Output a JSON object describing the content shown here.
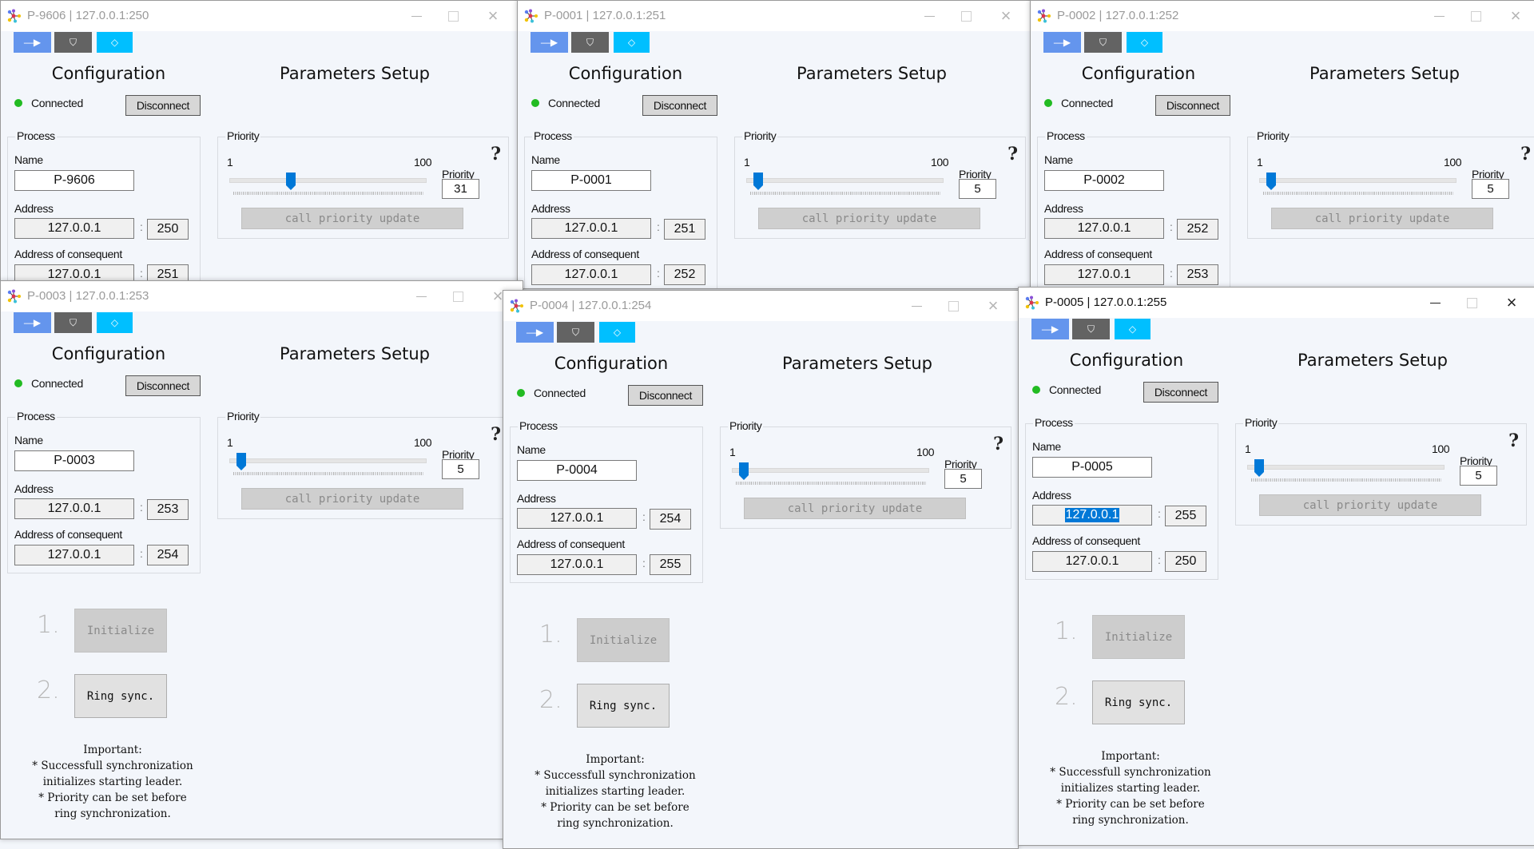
{
  "colors": {
    "toolbar_blue": "#6495ed",
    "toolbar_gray": "#636363",
    "toolbar_cyan": "#00bfff",
    "status_connected": "#22bb22",
    "slider_thumb": "#0078d7",
    "selection": "#0078d7"
  },
  "labels": {
    "configuration": "Configuration",
    "parameters_setup": "Parameters Setup",
    "status": "Connected",
    "disconnect": "Disconnect",
    "process_group": "Process",
    "name": "Name",
    "address": "Address",
    "address_of_consequent": "Address of consequent",
    "priority_group": "Priority",
    "slider_min": "1",
    "slider_max": "100",
    "priority_field": "Priority",
    "call_priority_update": "call priority update",
    "colon": ":",
    "help": "?",
    "step1_num": "1.",
    "step1_btn": "Initialize",
    "step2_num": "2.",
    "step2_btn": "Ring sync.",
    "note_lines": [
      "Important:",
      "* Successfull synchronization",
      "initializes starting leader.",
      "* Priority can be set before",
      "ring synchronization."
    ]
  },
  "toolbar": [
    {
      "icon": "arrow-right-icon",
      "glyph": "—▶"
    },
    {
      "icon": "shield-icon",
      "glyph": "⛉"
    },
    {
      "icon": "diamond-icon",
      "glyph": "◇"
    }
  ],
  "window_controls": {
    "minimize": "minimize",
    "maximize": "maximize",
    "close": "×"
  },
  "windows": [
    {
      "title": "P-9606 | 127.0.0.1:250",
      "name": "P-9606",
      "address": "127.0.0.1",
      "port": "250",
      "next_address": "127.0.0.1",
      "next_port": "251",
      "priority": "31",
      "slider_value": 31,
      "active": false,
      "address_selected": false
    },
    {
      "title": "P-0001 | 127.0.0.1:251",
      "name": "P-0001",
      "address": "127.0.0.1",
      "port": "251",
      "next_address": "127.0.0.1",
      "next_port": "252",
      "priority": "5",
      "slider_value": 5,
      "active": false,
      "address_selected": false
    },
    {
      "title": "P-0002 | 127.0.0.1:252",
      "name": "P-0002",
      "address": "127.0.0.1",
      "port": "252",
      "next_address": "127.0.0.1",
      "next_port": "253",
      "priority": "5",
      "slider_value": 5,
      "active": false,
      "address_selected": false
    },
    {
      "title": "P-0003 | 127.0.0.1:253",
      "name": "P-0003",
      "address": "127.0.0.1",
      "port": "253",
      "next_address": "127.0.0.1",
      "next_port": "254",
      "priority": "5",
      "slider_value": 5,
      "active": false,
      "address_selected": false
    },
    {
      "title": "P-0004 | 127.0.0.1:254",
      "name": "P-0004",
      "address": "127.0.0.1",
      "port": "254",
      "next_address": "127.0.0.1",
      "next_port": "255",
      "priority": "5",
      "slider_value": 5,
      "active": false,
      "address_selected": false
    },
    {
      "title": "P-0005 | 127.0.0.1:255",
      "name": "P-0005",
      "address": "127.0.0.1",
      "port": "255",
      "next_address": "127.0.0.1",
      "next_port": "250",
      "priority": "5",
      "slider_value": 5,
      "active": true,
      "address_selected": true
    }
  ],
  "slider_range": [
    1,
    100
  ]
}
